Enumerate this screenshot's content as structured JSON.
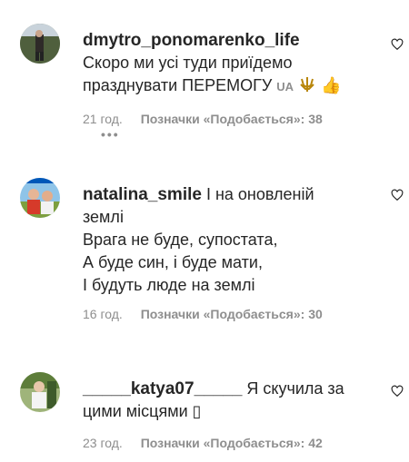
{
  "comments": [
    {
      "username": "dmytro_ponomarenko_life",
      "text_line1": "Скоро ми усі туди приїдемо",
      "text_line2": "празднувати ПЕРЕМОГУ",
      "emoji_flag": "UA",
      "emoji_trident": "trident-icon",
      "emoji_thumb": "👍",
      "time": "21 год.",
      "likes": "Позначки «Подобається»: 38",
      "replies_indicator": "•••"
    },
    {
      "username": "natalina_smile",
      "text_inline": " І на оновленій",
      "text_lines": [
        "землі",
        "Врага не буде, супостата,",
        "А буде син, і буде мати,",
        "І будуть люде на землі"
      ],
      "time": "16 год.",
      "likes": "Позначки «Подобається»: 30"
    },
    {
      "username": "_____katya07_____",
      "text_inline": " Я скучила за",
      "text_line2": "цими місцями ▯",
      "time": "23 год.",
      "likes": "Позначки «Подобається»: 42"
    }
  ],
  "colors": {
    "text": "#262626",
    "muted": "#8e8e8e",
    "accent_blue": "#0057b8",
    "accent_yellow": "#f5c518"
  }
}
